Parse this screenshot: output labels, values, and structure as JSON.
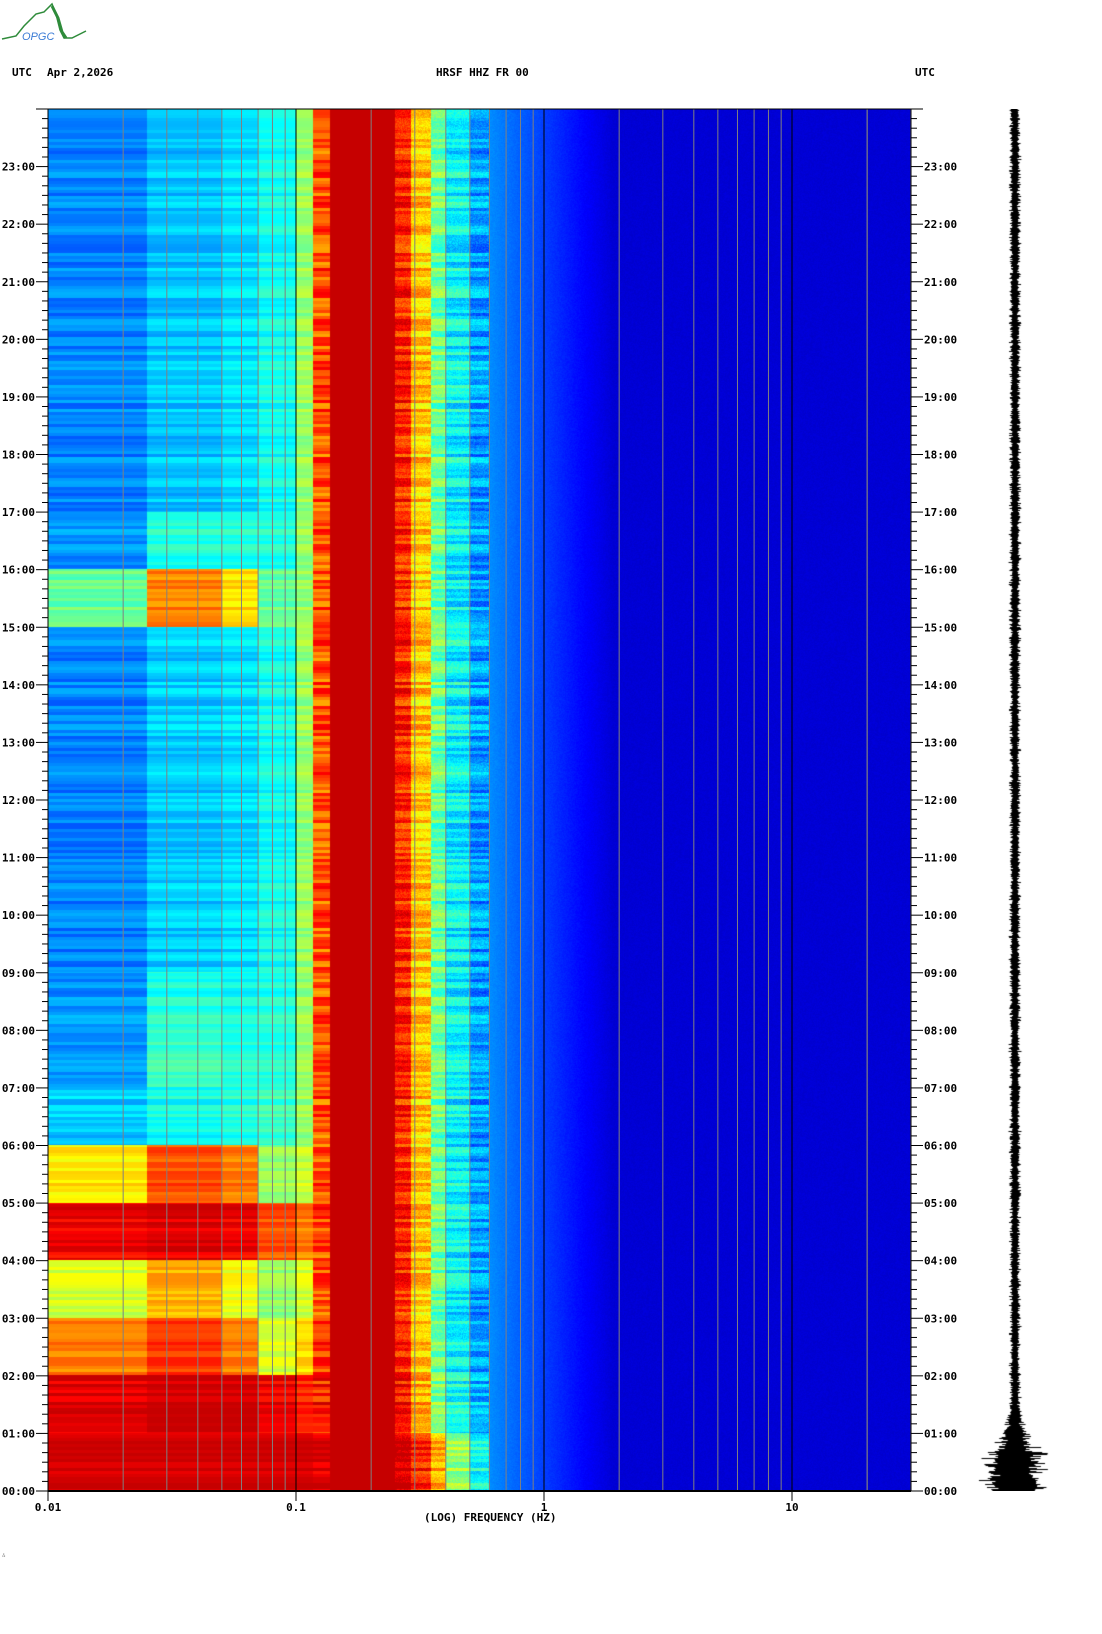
{
  "header": {
    "timezone_left": "UTC",
    "date": "Apr 2,2026",
    "station": "HRSF HHZ FR 00",
    "timezone_right": "UTC"
  },
  "logo": {
    "text": "OPGC",
    "colors": {
      "mountain": "#2e8b3a",
      "text": "#3a7bd5"
    }
  },
  "footer_mark": "∴",
  "chart_data": {
    "type": "heatmap",
    "title": "HRSF HHZ FR 00",
    "xlabel": "(LOG) FREQUENCY (HZ)",
    "xscale": "log",
    "xlim": [
      0.01,
      30
    ],
    "x_ticks": [
      {
        "value": 0.01,
        "label": "0.01"
      },
      {
        "value": 0.1,
        "label": "0.1"
      },
      {
        "value": 1,
        "label": "1"
      },
      {
        "value": 10,
        "label": "10"
      }
    ],
    "ylabel": "UTC",
    "ylim_hours": [
      0,
      24
    ],
    "y_ticks": [
      "00:00",
      "01:00",
      "02:00",
      "03:00",
      "04:00",
      "05:00",
      "06:00",
      "07:00",
      "08:00",
      "09:00",
      "10:00",
      "11:00",
      "12:00",
      "13:00",
      "14:00",
      "15:00",
      "16:00",
      "17:00",
      "18:00",
      "19:00",
      "20:00",
      "21:00",
      "22:00",
      "23:00"
    ],
    "y_minor_tick_minutes": 10,
    "colormap": "jet",
    "value_range": [
      0,
      1
    ],
    "freq_bin_edges_hz": [
      0.01,
      0.025,
      0.05,
      0.07,
      0.1,
      0.117,
      0.136,
      0.25,
      0.29,
      0.35,
      0.4,
      0.5,
      0.6,
      30
    ],
    "hourly_relative_power": [
      [
        1.0,
        1.0,
        1.0,
        1.0,
        1.0,
        1.0,
        1.0,
        1.0,
        0.9,
        0.75,
        0.55,
        0.4,
        0.12
      ],
      [
        0.97,
        1.0,
        1.0,
        0.95,
        0.9,
        0.9,
        1.0,
        0.92,
        0.75,
        0.52,
        0.4,
        0.3,
        0.1
      ],
      [
        0.8,
        0.88,
        0.8,
        0.62,
        0.7,
        0.88,
        1.0,
        0.9,
        0.72,
        0.5,
        0.38,
        0.28,
        0.1
      ],
      [
        0.62,
        0.75,
        0.65,
        0.55,
        0.62,
        0.86,
        1.0,
        0.9,
        0.72,
        0.5,
        0.38,
        0.28,
        0.1
      ],
      [
        0.95,
        0.97,
        0.95,
        0.85,
        0.8,
        0.86,
        1.0,
        0.9,
        0.72,
        0.5,
        0.38,
        0.28,
        0.1
      ],
      [
        0.68,
        0.85,
        0.8,
        0.55,
        0.6,
        0.85,
        1.0,
        0.9,
        0.72,
        0.5,
        0.38,
        0.28,
        0.1
      ],
      [
        0.33,
        0.4,
        0.42,
        0.45,
        0.55,
        0.85,
        1.0,
        0.9,
        0.72,
        0.5,
        0.38,
        0.28,
        0.1
      ],
      [
        0.27,
        0.45,
        0.42,
        0.42,
        0.55,
        0.85,
        1.0,
        0.9,
        0.72,
        0.5,
        0.38,
        0.28,
        0.1
      ],
      [
        0.27,
        0.42,
        0.4,
        0.42,
        0.55,
        0.85,
        1.0,
        0.9,
        0.72,
        0.5,
        0.38,
        0.28,
        0.1
      ],
      [
        0.25,
        0.33,
        0.35,
        0.4,
        0.55,
        0.85,
        1.0,
        0.9,
        0.72,
        0.5,
        0.38,
        0.28,
        0.1
      ],
      [
        0.25,
        0.33,
        0.35,
        0.4,
        0.55,
        0.85,
        1.0,
        0.9,
        0.72,
        0.5,
        0.38,
        0.28,
        0.1
      ],
      [
        0.25,
        0.33,
        0.35,
        0.4,
        0.55,
        0.85,
        1.0,
        0.9,
        0.72,
        0.5,
        0.38,
        0.28,
        0.1
      ],
      [
        0.25,
        0.33,
        0.35,
        0.4,
        0.55,
        0.85,
        1.0,
        0.9,
        0.72,
        0.5,
        0.38,
        0.28,
        0.1
      ],
      [
        0.25,
        0.33,
        0.35,
        0.4,
        0.55,
        0.85,
        1.0,
        0.9,
        0.72,
        0.5,
        0.38,
        0.28,
        0.1
      ],
      [
        0.25,
        0.33,
        0.35,
        0.4,
        0.55,
        0.85,
        1.0,
        0.9,
        0.72,
        0.5,
        0.38,
        0.28,
        0.1
      ],
      [
        0.5,
        0.8,
        0.7,
        0.5,
        0.55,
        0.85,
        1.0,
        0.9,
        0.72,
        0.5,
        0.38,
        0.28,
        0.1
      ],
      [
        0.27,
        0.42,
        0.42,
        0.42,
        0.55,
        0.85,
        1.0,
        0.9,
        0.72,
        0.5,
        0.38,
        0.28,
        0.1
      ],
      [
        0.25,
        0.32,
        0.35,
        0.4,
        0.55,
        0.85,
        1.0,
        0.9,
        0.72,
        0.5,
        0.38,
        0.28,
        0.1
      ],
      [
        0.25,
        0.32,
        0.35,
        0.4,
        0.55,
        0.85,
        1.0,
        0.9,
        0.72,
        0.5,
        0.38,
        0.28,
        0.1
      ],
      [
        0.25,
        0.32,
        0.35,
        0.4,
        0.55,
        0.85,
        1.0,
        0.9,
        0.72,
        0.5,
        0.38,
        0.28,
        0.1
      ],
      [
        0.25,
        0.32,
        0.35,
        0.4,
        0.55,
        0.85,
        1.0,
        0.9,
        0.72,
        0.5,
        0.38,
        0.28,
        0.1
      ],
      [
        0.25,
        0.32,
        0.35,
        0.4,
        0.55,
        0.85,
        1.0,
        0.9,
        0.72,
        0.5,
        0.38,
        0.28,
        0.1
      ],
      [
        0.25,
        0.32,
        0.35,
        0.4,
        0.55,
        0.85,
        1.0,
        0.9,
        0.72,
        0.5,
        0.38,
        0.28,
        0.1
      ],
      [
        0.25,
        0.32,
        0.35,
        0.4,
        0.55,
        0.85,
        1.0,
        0.9,
        0.72,
        0.5,
        0.38,
        0.28,
        0.1
      ]
    ],
    "waveform": {
      "peak_hour": 0.5,
      "relative_amplitude_quiet": 0.12,
      "relative_amplitude_peak": 1.0
    },
    "grid": {
      "decade_lines": "#000000",
      "minor_lines": "#808080"
    }
  }
}
